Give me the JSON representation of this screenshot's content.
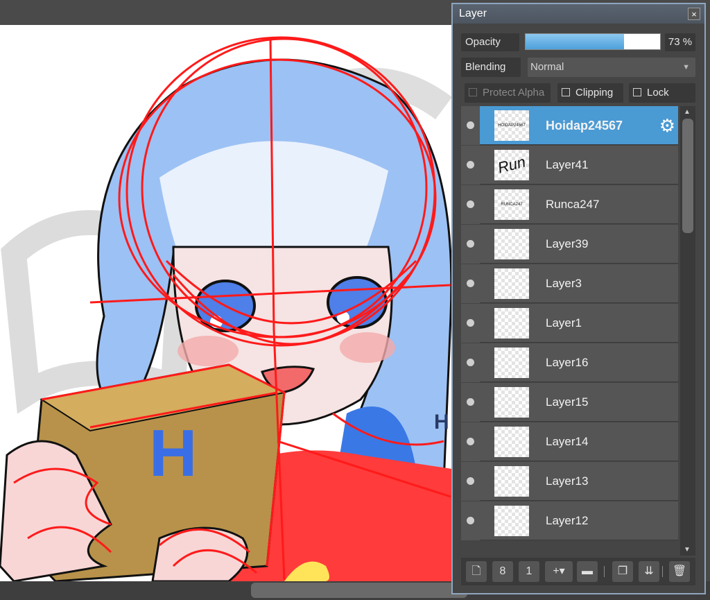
{
  "panel": {
    "title": "Layer",
    "close_label": "×",
    "opacity": {
      "label": "Opacity",
      "value": 0.73,
      "text": "73 %"
    },
    "blending": {
      "label": "Blending",
      "selected": "Normal"
    },
    "checkboxes": [
      {
        "label": "Protect Alpha",
        "checked": false,
        "enabled": false
      },
      {
        "label": "Clipping",
        "checked": false,
        "enabled": true
      },
      {
        "label": "Lock",
        "checked": false,
        "enabled": true
      }
    ],
    "layers": [
      {
        "name": "Hoidap24567",
        "selected": true,
        "thumb_text": "HOIDAP24567"
      },
      {
        "name": "Layer41",
        "selected": false,
        "thumb_text": "Run"
      },
      {
        "name": "Runca247",
        "selected": false,
        "thumb_text": "RUNCA247"
      },
      {
        "name": "Layer39",
        "selected": false
      },
      {
        "name": "Layer3",
        "selected": false
      },
      {
        "name": "Layer1",
        "selected": false
      },
      {
        "name": "Layer16",
        "selected": false
      },
      {
        "name": "Layer15",
        "selected": false
      },
      {
        "name": "Layer14",
        "selected": false
      },
      {
        "name": "Layer13",
        "selected": false
      },
      {
        "name": "Layer12",
        "selected": false
      }
    ],
    "toolbar": [
      {
        "icon": "new-layer-icon",
        "glyph": "🗋"
      },
      {
        "icon": "new-8bit-layer-icon",
        "glyph": "8"
      },
      {
        "icon": "new-1bit-layer-icon",
        "glyph": "1"
      },
      {
        "icon": "add-layer-dropdown-icon",
        "glyph": "+▾"
      },
      {
        "icon": "folder-icon",
        "glyph": "▬"
      },
      {
        "icon": "duplicate-layer-icon",
        "glyph": "❐"
      },
      {
        "icon": "merge-down-icon",
        "glyph": "⇊"
      },
      {
        "icon": "delete-layer-icon",
        "glyph": "🗑"
      }
    ]
  },
  "canvas": {
    "box_letter": "H",
    "watermark_letter": "H"
  },
  "colors": {
    "accent": "#4a9ad4",
    "sketch_red": "#ff1a1a",
    "hair_blue": "#5b8fe8"
  }
}
